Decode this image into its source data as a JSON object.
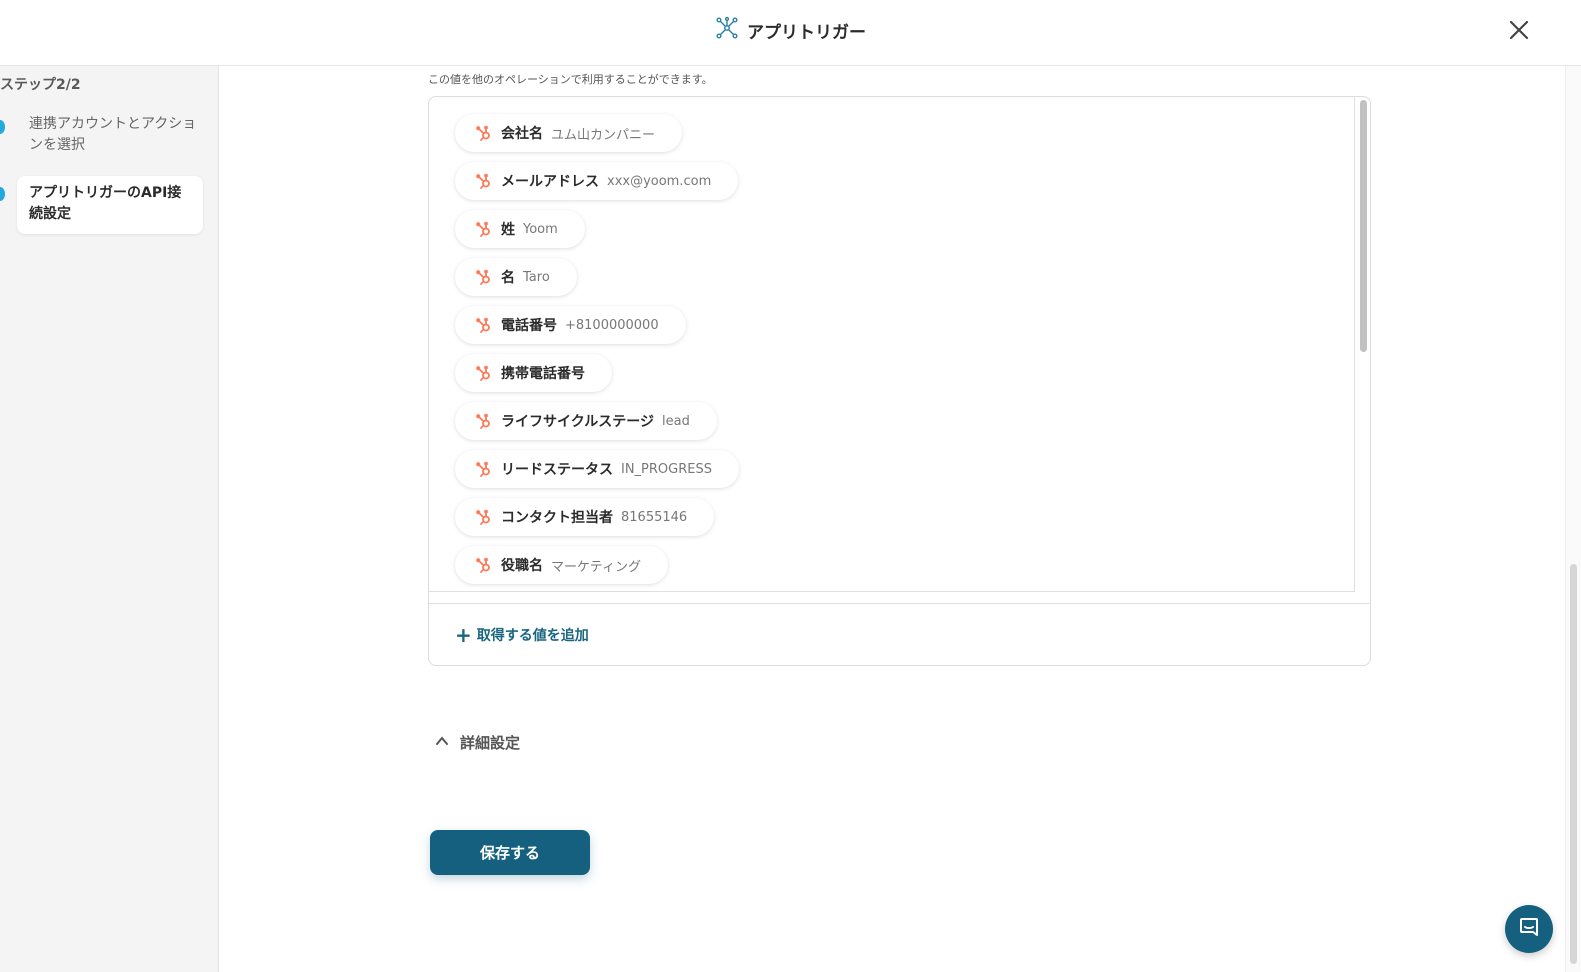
{
  "header": {
    "title": "アプリトリガー",
    "app_icon": "network-icon",
    "close_icon": "close-icon"
  },
  "sidebar": {
    "step_count": "ステップ2/2",
    "steps": [
      {
        "label": "連携アカウントとアクションを選択",
        "active": false
      },
      {
        "label": "アプリトリガーのAPI接続設定",
        "active": true
      }
    ]
  },
  "main": {
    "description": "この値を他のオペレーションで利用することができます。",
    "fields": [
      {
        "key": "会社名",
        "value": "ユム山カンパニー"
      },
      {
        "key": "メールアドレス",
        "value": "xxx@yoom.com"
      },
      {
        "key": "姓",
        "value": "Yoom"
      },
      {
        "key": "名",
        "value": "Taro"
      },
      {
        "key": "電話番号",
        "value": "+8100000000"
      },
      {
        "key": "携帯電話番号",
        "value": ""
      },
      {
        "key": "ライフサイクルステージ",
        "value": "lead"
      },
      {
        "key": "リードステータス",
        "value": "IN_PROGRESS"
      },
      {
        "key": "コンタクト担当者",
        "value": "81655146"
      },
      {
        "key": "役職名",
        "value": "マーケティング"
      }
    ],
    "add_value_label": "取得する値を追加",
    "details_label": "詳細設定",
    "save_label": "保存する"
  },
  "colors": {
    "accent": "#14607e",
    "hubspot": "#ff7a59",
    "step_dot": "#22a9dd"
  }
}
